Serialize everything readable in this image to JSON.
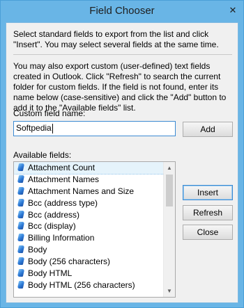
{
  "window": {
    "title": "Field Chooser",
    "close_glyph": "✕"
  },
  "intro_text": "Select standard fields to export from the list and click \"Insert\". You may select several fields at the same time.",
  "custom_text": "You may also export custom (user-defined) text fields created in Outlook. Click \"Refresh\" to search the current folder for custom fields. If the field is not found, enter its name below (case-sensitive) and click the \"Add\" button to add it to the \"Available fields\" list.",
  "custom_field": {
    "label": "Custom field name:",
    "value": "Softpedia"
  },
  "add_button": "Add",
  "available_fields": {
    "label": "Available fields:",
    "items": [
      "Attachment Count",
      "Attachment Names",
      "Attachment Names and Size",
      "Bcc (address type)",
      "Bcc (address)",
      "Bcc (display)",
      "Billing Information",
      "Body",
      "Body (256 characters)",
      "Body HTML",
      "Body HTML (256 characters)"
    ],
    "selected_index": 0
  },
  "buttons": {
    "insert": "Insert",
    "refresh": "Refresh",
    "close": "Close"
  },
  "icons": {
    "field_item": "field-icon",
    "close": "close-icon"
  }
}
